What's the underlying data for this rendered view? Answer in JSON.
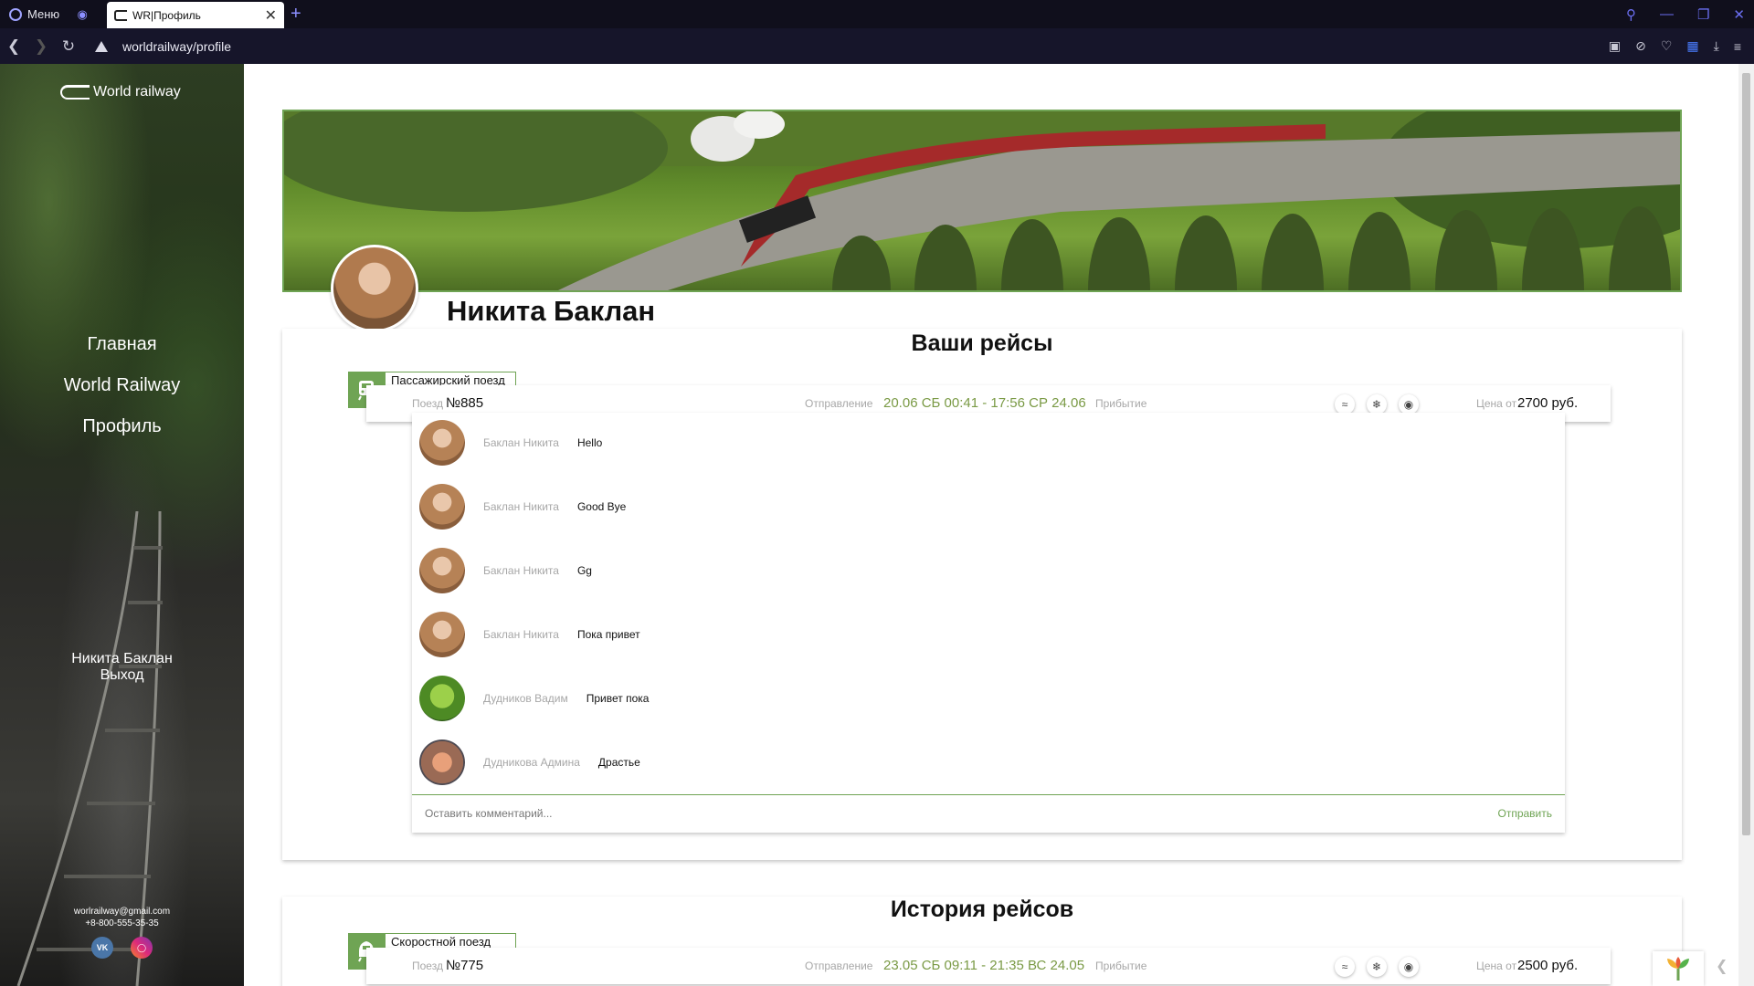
{
  "browser": {
    "menu_label": "Меню",
    "tab_title": "WR|Профиль",
    "url": "worldrailway/profile"
  },
  "sidebar": {
    "logo_text": "World railway",
    "nav": [
      {
        "label": "Главная"
      },
      {
        "label": "World Railway"
      },
      {
        "label": "Профиль"
      }
    ],
    "user_name": "Никита Баклан",
    "logout_label": "Выход",
    "email": "worlrailway@gmail.com",
    "phone": "+8-800-555-35-35",
    "social": [
      {
        "icon": "vk-icon",
        "text": "VK"
      },
      {
        "icon": "instagram-icon",
        "text": ""
      }
    ]
  },
  "profile": {
    "name": "Никита Баклан"
  },
  "current_trips": {
    "title": "Ваши рейсы",
    "trip": {
      "train_type": "Пассажирский поезд",
      "train_label": "Поезд",
      "train_number": "№885",
      "departure_label": "Отправление",
      "schedule": "20.06 СБ 00:41 - 17:56 СР 24.06",
      "arrival_label": "Прибытие",
      "amenities": [
        "wifi-icon",
        "snowflake-icon",
        "pet-icon"
      ],
      "price_label": "Цена от",
      "price": "2700 руб."
    },
    "comments": [
      {
        "author": "Баклан Никита",
        "text": "Hello",
        "avatar": "woman"
      },
      {
        "author": "Баклан Никита",
        "text": "Good Bye",
        "avatar": "woman"
      },
      {
        "author": "Баклан Никита",
        "text": "Gg",
        "avatar": "woman"
      },
      {
        "author": "Баклан Никита",
        "text": "Пока привет",
        "avatar": "woman"
      },
      {
        "author": "Дудников Вадим",
        "text": "Привет пока",
        "avatar": "frog"
      },
      {
        "author": "Дудникова Админа",
        "text": "Драстье",
        "avatar": "fish"
      }
    ],
    "comment_placeholder": "Оставить комментарий...",
    "send_label": "Отправить"
  },
  "history": {
    "title": "История рейсов",
    "trip": {
      "train_type": "Скоростной поезд",
      "train_label": "Поезд",
      "train_number": "№775",
      "departure_label": "Отправление",
      "schedule": "23.05 СБ 09:11 - 21:35 ВС 24.05",
      "arrival_label": "Прибытие",
      "price_label": "Цена от",
      "price": "2500 руб."
    }
  },
  "colors": {
    "accent": "#6fa454",
    "schedule_text": "#7a9a45",
    "browser_bg": "#100f1c"
  }
}
